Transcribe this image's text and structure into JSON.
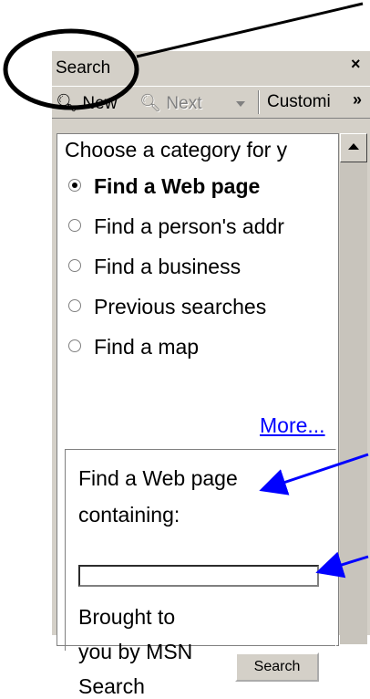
{
  "pane": {
    "title": "Search",
    "close_glyph": "×",
    "toolbar": {
      "new_label": "New",
      "next_label": "Next",
      "customize_label": "Customi",
      "chevron_glyph": "»"
    }
  },
  "content": {
    "prompt": "Choose a category for y",
    "options": [
      {
        "label": "Find a Web page",
        "selected": true
      },
      {
        "label": "Find a person's addr",
        "selected": false
      },
      {
        "label": "Find a business",
        "selected": false
      },
      {
        "label": "Previous searches",
        "selected": false
      },
      {
        "label": "Find a map",
        "selected": false
      }
    ],
    "more_link": "More...",
    "box": {
      "line1": "Find a Web page",
      "line2": "containing:",
      "input_value": "",
      "brought_line1": "Brought to",
      "brought_line2": "you by MSN",
      "brought_line3": "Search",
      "search_button": "Search"
    }
  },
  "colors": {
    "pane_bg": "#d4d0c8",
    "link": "#0000ff",
    "annotation_arrow": "#0000ff",
    "annotation_ellipse": "#000000"
  }
}
